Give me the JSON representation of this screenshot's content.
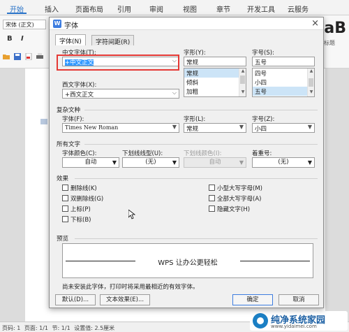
{
  "ribbon": {
    "tabs": [
      "开始",
      "插入",
      "页面布局",
      "引用",
      "审阅",
      "视图",
      "章节",
      "开发工具",
      "云服务"
    ],
    "font_combo": "宋体 (正文)",
    "bold": "B",
    "italic": "I",
    "style_preview": "AaB",
    "style_label": "标题"
  },
  "dialog": {
    "title": "字体",
    "close_label": "×",
    "tabs": [
      "字体(N)",
      "字符间距(R)"
    ],
    "chinese_font": {
      "label": "中文字体(T):",
      "value": "+中文正文"
    },
    "western_font": {
      "label": "西文字体(X):",
      "value": "+西文正文"
    },
    "font_style": {
      "label": "字形(Y):",
      "value": "常规",
      "options": [
        "常规",
        "倾斜",
        "加粗"
      ]
    },
    "font_size": {
      "label": "字号(S):",
      "value": "五号",
      "options": [
        "四号",
        "小四",
        "五号"
      ]
    },
    "complex": {
      "section_title": "复杂文种",
      "font_label": "字体(F):",
      "font_value": "Times New Roman",
      "style_label": "字形(L):",
      "style_value": "常规",
      "size_label": "字号(Z):",
      "size_value": "小四"
    },
    "all_text": {
      "section_title": "所有文字",
      "color_label": "字体颜色(C):",
      "color_value": "自动",
      "underline_type_label": "下划线线型(U):",
      "underline_type_value": "(无)",
      "underline_color_label": "下划线颜色(I):",
      "underline_color_value": "自动",
      "emphasis_label": "着重号:",
      "emphasis_value": "(无)"
    },
    "effects": {
      "section_title": "效果",
      "left": [
        "删除线(K)",
        "双删除线(G)",
        "上标(P)",
        "下标(B)"
      ],
      "right": [
        "小型大写字母(M)",
        "全部大写字母(A)",
        "隐藏文字(H)"
      ]
    },
    "preview": {
      "section_title": "预览",
      "sample": "WPS 让办公更轻松"
    },
    "note": "尚未安装此字体，打印时将采用最相近的有效字体。",
    "buttons": {
      "default": "默认(D)...",
      "text_effects": "文本效果(E)...",
      "ok": "确定",
      "cancel": "取消"
    }
  },
  "status": {
    "page_num": "页码: 1",
    "pages": "页面: 1/1",
    "section": "节: 1/1",
    "setting": "设置值: 2.5厘米"
  },
  "watermark": {
    "title": "纯净系统家园",
    "url": "www.yidaimei.com"
  },
  "colors": {
    "accent": "#2b74c8",
    "highlight_frame": "#e53935",
    "selection": "#3399ff"
  }
}
